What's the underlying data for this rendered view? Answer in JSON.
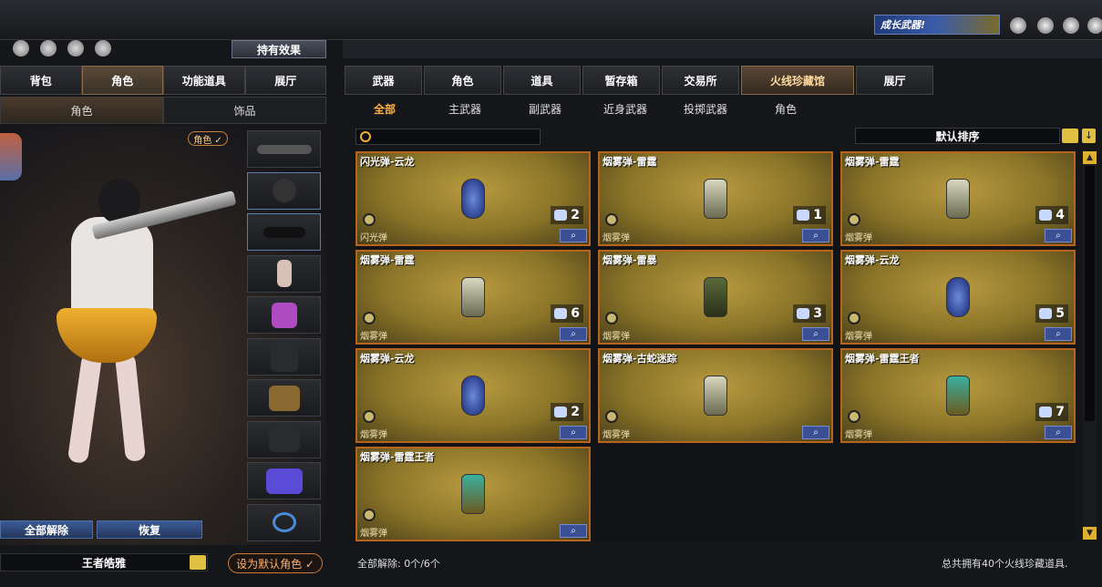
{
  "left": {
    "effect_button": "持有效果",
    "tabs": [
      "背包",
      "角色",
      "功能道具",
      "展厅"
    ],
    "subtabs": [
      "角色",
      "饰品"
    ],
    "role_tag": "角色 ✓",
    "unequip_all": "全部解除",
    "restore": "恢复",
    "character_name": "王者皓雅",
    "set_default": "设为默认角色 ✓"
  },
  "promo": {
    "label": "成长武器!"
  },
  "right": {
    "tabs": [
      "武器",
      "角色",
      "道具",
      "暂存箱",
      "交易所",
      "火线珍藏馆",
      "展厅"
    ],
    "subtabs": [
      "全部",
      "主武器",
      "副武器",
      "近身武器",
      "投掷武器",
      "角色"
    ],
    "sort_label": "默认排序",
    "items": [
      {
        "title": "闪光弹-云龙",
        "type": "闪光弹",
        "count": "2",
        "style": "blue"
      },
      {
        "title": "烟雾弹-雷霆",
        "type": "烟雾弹",
        "count": "1",
        "style": "plain"
      },
      {
        "title": "烟雾弹-雷霆",
        "type": "烟雾弹",
        "count": "4",
        "style": "plain"
      },
      {
        "title": "烟雾弹-雷霆",
        "type": "烟雾弹",
        "count": "6",
        "style": "plain"
      },
      {
        "title": "烟雾弹-雷暴",
        "type": "烟雾弹",
        "count": "3",
        "style": "green"
      },
      {
        "title": "烟雾弹-云龙",
        "type": "烟雾弹",
        "count": "5",
        "style": "blue"
      },
      {
        "title": "烟雾弹-云龙",
        "type": "烟雾弹",
        "count": "2",
        "style": "blue"
      },
      {
        "title": "烟雾弹-古蛇迷踪",
        "type": "烟雾弹",
        "count": "",
        "style": "plain"
      },
      {
        "title": "烟雾弹-雷霆王者",
        "type": "烟雾弹",
        "count": "7",
        "style": "teal"
      },
      {
        "title": "烟雾弹-雷霆王者",
        "type": "烟雾弹",
        "count": "",
        "style": "teal"
      }
    ],
    "footer_left": "全部解除: 0个/6个",
    "footer_right": "总共拥有40个火线珍藏道具."
  }
}
